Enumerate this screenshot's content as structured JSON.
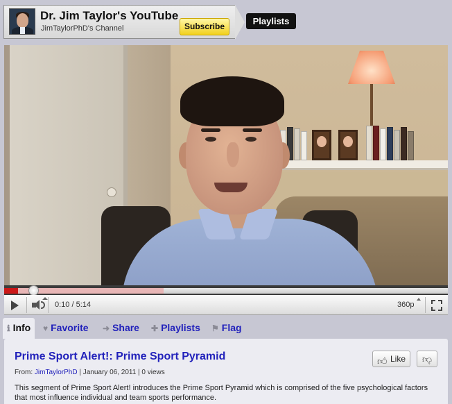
{
  "header": {
    "channel_title": "Dr. Jim Taylor's YouTube",
    "channel_subtitle": "JimTaylorPhD's Channel",
    "subscribe_label": "Subscribe",
    "playlists_label": "Playlists"
  },
  "player": {
    "time_display": "0:10 / 5:14",
    "quality": "360p",
    "played_fraction": 0.032,
    "loaded_fraction": 0.36
  },
  "tabs": [
    {
      "label": "Info",
      "icon": "info-icon",
      "active": true
    },
    {
      "label": "Favorite",
      "icon": "heart-icon",
      "active": false
    },
    {
      "label": "Share",
      "icon": "share-arrow-icon",
      "active": false
    },
    {
      "label": "Playlists",
      "icon": "plus-icon",
      "active": false
    },
    {
      "label": "Flag",
      "icon": "flag-icon",
      "active": false
    }
  ],
  "video_info": {
    "title": "Prime Sport Alert!: Prime Sport Pyramid",
    "from_label": "From:",
    "author": "JimTaylorPhD",
    "meta_rest": "| January 06, 2011  | 0 views",
    "description": "This segment of Prime Sport Alert! introduces the Prime Sport Pyramid which is comprised of the five psychological factors that most influence individual and team sports performance.",
    "like_label": "Like"
  },
  "colors": {
    "link_blue": "#2222bb",
    "subscribe_yellow": "#f2d11d",
    "progress_red": "#cc1818",
    "page_bg": "#c7c7d3"
  }
}
